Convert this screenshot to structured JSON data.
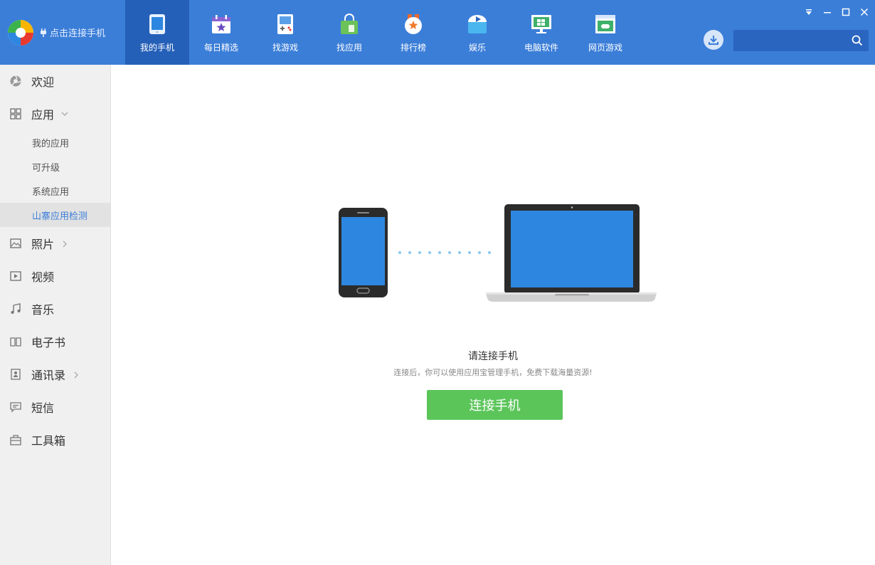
{
  "header": {
    "connect_link": "点击连接手机",
    "search_placeholder": "",
    "nav": [
      {
        "label": "我的手机",
        "icon": "phone-icon",
        "active": true
      },
      {
        "label": "每日精选",
        "icon": "calendar-star-icon"
      },
      {
        "label": "找游戏",
        "icon": "gameboy-icon"
      },
      {
        "label": "找应用",
        "icon": "shopping-bag-icon"
      },
      {
        "label": "排行榜",
        "icon": "medal-icon"
      },
      {
        "label": "娱乐",
        "icon": "entertainment-icon"
      },
      {
        "label": "电脑软件",
        "icon": "monitor-icon"
      },
      {
        "label": "网页游戏",
        "icon": "web-game-icon"
      }
    ]
  },
  "sidebar": {
    "items": [
      {
        "label": "欢迎",
        "icon": "welcome-icon"
      },
      {
        "label": "应用",
        "icon": "apps-grid-icon",
        "expanded": true
      },
      {
        "label": "照片",
        "icon": "photo-icon"
      },
      {
        "label": "视频",
        "icon": "video-icon"
      },
      {
        "label": "音乐",
        "icon": "music-icon"
      },
      {
        "label": "电子书",
        "icon": "ebook-icon"
      },
      {
        "label": "通讯录",
        "icon": "contacts-icon"
      },
      {
        "label": "短信",
        "icon": "sms-icon"
      },
      {
        "label": "工具箱",
        "icon": "toolbox-icon"
      }
    ],
    "app_subitems": [
      "我的应用",
      "可升级",
      "系统应用",
      "山寨应用检测"
    ],
    "active_subitem": "山寨应用检测"
  },
  "main": {
    "title": "请连接手机",
    "subtitle": "连接后，你可以使用应用宝管理手机，免费下载海量资源!",
    "connect_button": "连接手机"
  },
  "colors": {
    "header_bg": "#3b7ed8",
    "nav_active_bg": "#2560b8",
    "sidebar_bg": "#f0f0f0",
    "accent": "#3b7ed8",
    "button_green": "#5bc55a",
    "device_screen": "#2d87e0"
  }
}
